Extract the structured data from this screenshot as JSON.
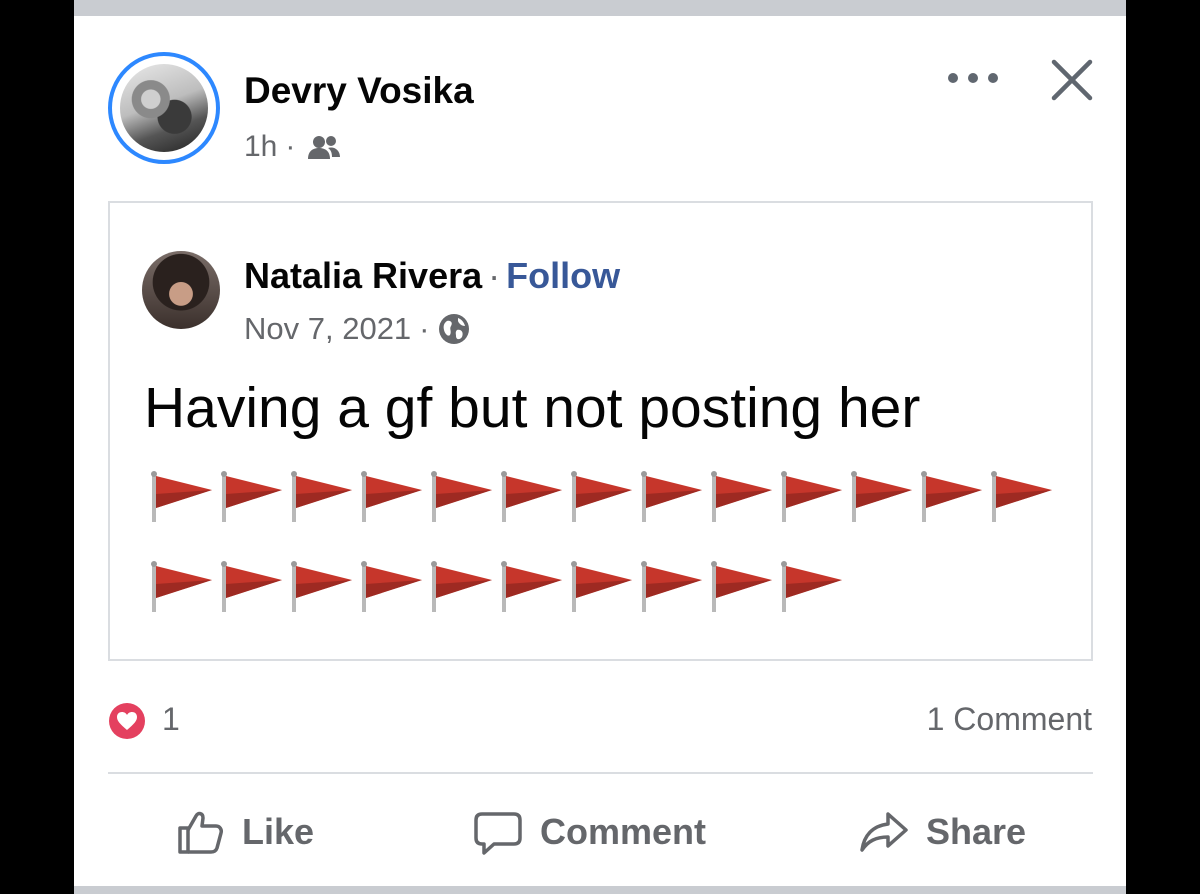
{
  "post": {
    "author_name": "Devry Vosika",
    "time": "1h",
    "meta_sep": "·",
    "audience_icon": "friends-icon",
    "more_icon": "more-options-icon",
    "close_icon": "close-icon"
  },
  "shared_post": {
    "author_name": "Natalia Rivera",
    "sep": "·",
    "follow_label": "Follow",
    "date": "Nov 7, 2021",
    "meta_sep": "·",
    "audience_icon": "globe-icon",
    "text": "Having a gf but not posting her",
    "flags_row1_count": 13,
    "flags_row2_count": 10,
    "flag_icon": "triangular-red-flag"
  },
  "reactions": {
    "icon": "heart-reaction-icon",
    "count": "1",
    "comments": "1 Comment"
  },
  "actions": {
    "like_label": "Like",
    "comment_label": "Comment",
    "share_label": "Share"
  },
  "colors": {
    "link": "#385898",
    "avatar_ring": "#2d88ff",
    "muted_text": "#65676b",
    "flag_red": "#c6362b",
    "heart_red": "#e4405f"
  }
}
